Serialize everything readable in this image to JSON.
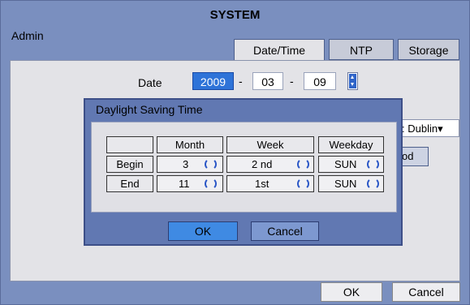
{
  "window": {
    "title": "SYSTEM",
    "section": "Admin"
  },
  "tabs": [
    {
      "label": "Date/Time",
      "active": true
    },
    {
      "label": "NTP",
      "active": false
    },
    {
      "label": "Storage",
      "active": false
    }
  ],
  "date": {
    "label": "Date",
    "year": "2009",
    "month": "03",
    "day": "09",
    "separator": "-"
  },
  "timezone": {
    "value": ": Dublin",
    "arrow": "▾"
  },
  "period_button": {
    "label": "od"
  },
  "dst_dialog": {
    "title": "Daylight Saving Time",
    "headers": [
      "Month",
      "Week",
      "Weekday"
    ],
    "rows": [
      {
        "label": "Begin",
        "month": "3",
        "week": "2 nd",
        "weekday": "SUN"
      },
      {
        "label": "End",
        "month": "11",
        "week": "1st",
        "weekday": "SUN"
      }
    ],
    "ok_label": "OK",
    "cancel_label": "Cancel"
  },
  "footer": {
    "ok_label": "OK",
    "cancel_label": "Cancel"
  },
  "colors": {
    "accent": "#2e73d8",
    "frame": "#7a8fbf",
    "dialog": "#6178b2",
    "panel": "#e3e3e7"
  }
}
